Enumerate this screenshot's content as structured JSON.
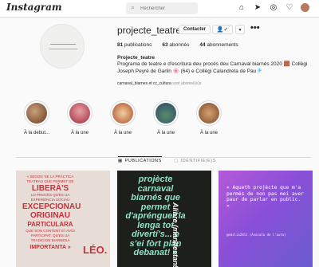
{
  "nav": {
    "logo": "Instagram",
    "search_placeholder": "Rechercher"
  },
  "profile": {
    "username": "projecte_teatre",
    "contact_label": "Contacter",
    "follow_icon": "person-check-icon",
    "more_label": "•••"
  },
  "stats": {
    "posts": "81",
    "posts_label": "publications",
    "followers": "63",
    "followers_label": "abonnés",
    "following": "44",
    "following_label": "abonnements"
  },
  "bio": {
    "name": "Projecte_teatre",
    "text": "Programa de teatre e d'escritura deu procés deu Carnaval biarnés 2020 🟫 Collègi Joseph Peyré de Garlin 🌸 (64) e Collègi Calandreta de Pau🎐",
    "followed_by_names": "carnaval_biarnes et cc_cultura",
    "followed_by_suffix": "sont abonné(e)s"
  },
  "highlights": [
    {
      "label": "À la debut...",
      "color": "#8a5a3a"
    },
    {
      "label": "À la une",
      "color": "#b33a4a"
    },
    {
      "label": "À la une",
      "color": "#c56a3a"
    },
    {
      "label": "À la une",
      "color": "#3a6a8a"
    },
    {
      "label": "À la une",
      "color": "#a86a3a"
    }
  ],
  "tabs": {
    "publications": "PUBLICATIONS",
    "tagged": "IDENTIFIÉ(E)S"
  },
  "posts": {
    "p1": {
      "line1": "« SEGON 'SE LA PRÀCTICA TEATRAU QUE PERMET DE",
      "line2": "LIBERÀ'S",
      "line3": "LO PROCÈS QU'ES UA EXPERIÉNCIA SOCIAU",
      "line4": "EXCEPCIONAU",
      "line5": "ORIGINAU",
      "line6": "PARTICULARA",
      "line7": "QUE SON CONTENT E'I AVOI PARTICIPAT. QU'ES UA TRADICION BIARNESA",
      "line8": "IMPORTANTA »",
      "signature": "LÉO."
    },
    "p2": {
      "text": "projècte carnaval biarnés que permet d'aprénguer la lenga tot divertí's... e s'ei fòrt plan debanat! »",
      "side": "Alibre (manifestanta)"
    },
    "p3": {
      "text": "« Aqueth projècte que m'a permés de non pas mei aver paur de parlar en public. »",
      "credit": "@emilia2011 (Avocata de l'auta)"
    }
  }
}
